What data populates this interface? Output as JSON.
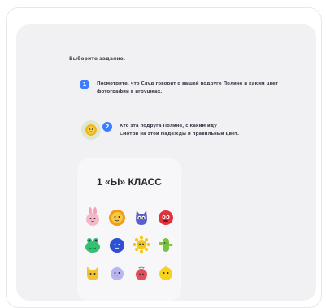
{
  "instructions": {
    "heading": "Выберите задание.",
    "step1": {
      "number": "1",
      "text_line1": "Посмотрите, что Слуд говорит о вашей подруге Полине и каким цвет",
      "text_line2": "фотографии в игрушках."
    },
    "step2": {
      "number": "2",
      "text_line1": "Кто эта подруга Полине, с каким иду",
      "text_line2": "Смотри на этой Надежды и правильный цвет."
    }
  },
  "class_card": {
    "title": "1 «Ы» КЛАСС"
  },
  "icons": {
    "step_badge": "numbered-step-icon",
    "avatar": "lion-mascot-icon",
    "animals": [
      "pink-bunny-icon",
      "yellow-lion-icon",
      "blue-owl-icon",
      "red-monster-icon",
      "green-frog-icon",
      "blue-ball-icon",
      "yellow-sun-icon",
      "green-cactus-icon",
      "yellow-cat-icon",
      "lavender-bird-icon",
      "red-berry-icon",
      "yellow-chick-icon"
    ]
  },
  "colors": {
    "accent": "#3d7bff",
    "panel": "#f1f1f3",
    "card": "#f7f7f9"
  }
}
